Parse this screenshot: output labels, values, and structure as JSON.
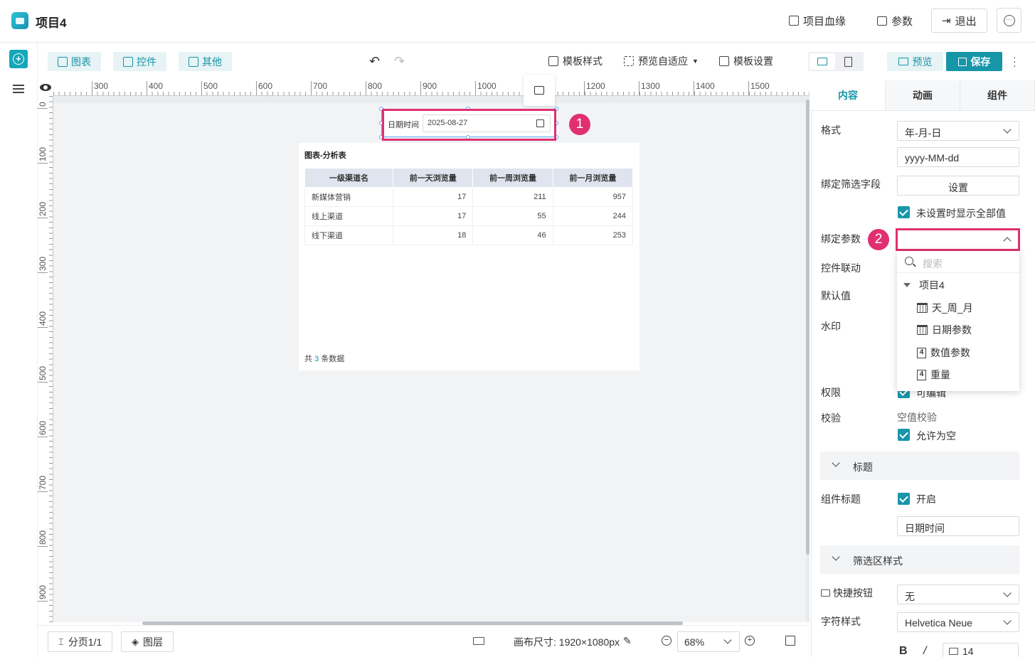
{
  "header": {
    "title": "项目4",
    "lineage_label": "项目血缘",
    "params_label": "参数",
    "exit_label": "退出",
    "more_icon": "ellipsis-icon"
  },
  "toolbar": {
    "chart_label": "图表",
    "control_label": "控件",
    "other_label": "其他",
    "template_style_label": "模板样式",
    "preview_fit_label": "预览自适应",
    "template_settings_label": "模板设置",
    "preview_label": "预览",
    "save_label": "保存"
  },
  "rulers": {
    "h": [
      "300",
      "400",
      "500",
      "600",
      "700",
      "800",
      "900",
      "1000",
      "1200",
      "1300",
      "1400",
      "1500"
    ],
    "v": [
      "0",
      "100",
      "200",
      "300",
      "400",
      "500",
      "600",
      "700",
      "800",
      "900"
    ]
  },
  "date_widget": {
    "label": "日期时间",
    "value": "2025-08-27"
  },
  "table_widget": {
    "title": "图表-分析表",
    "columns": [
      "一级渠道名",
      "前一天浏览量",
      "前一周浏览量",
      "前一月浏览量"
    ],
    "rows": [
      [
        "新媒体营销",
        "17",
        "211",
        "957"
      ],
      [
        "线上渠道",
        "17",
        "55",
        "244"
      ],
      [
        "线下渠道",
        "18",
        "46",
        "253"
      ]
    ],
    "footer_prefix": "共",
    "footer_count": "3",
    "footer_suffix": "条数据"
  },
  "annotations": {
    "badge1": "1",
    "badge2": "2"
  },
  "bottombar": {
    "page_label": "分页1/1",
    "layer_label": "图层",
    "canvas_size_label": "画布尺寸:",
    "canvas_size_value": "1920×1080px",
    "zoom_value": "68%"
  },
  "panel": {
    "tabs": [
      "内容",
      "动画",
      "组件"
    ],
    "format_label": "格式",
    "format_value": "年-月-日",
    "format_pattern": "yyyy-MM-dd",
    "bind_filter_label": "绑定筛选字段",
    "set_button": "设置",
    "show_all_label": "未设置时显示全部值",
    "bind_param_label": "绑定参数",
    "linkage_label": "控件联动",
    "default_label": "默认值",
    "watermark_label": "水印",
    "permission_label": "权限",
    "permission_value": "可编辑",
    "validate_label": "校验",
    "null_check_label": "空值校验",
    "allow_null_label": "允许为空",
    "title_section": "标题",
    "component_title_label": "组件标题",
    "enable_label": "开启",
    "title_value": "日期时间",
    "filter_style_section": "筛选区样式",
    "quick_button_label": "快捷按钮",
    "quick_button_value": "无",
    "font_style_label": "字符样式",
    "font_value": "Helvetica Neue",
    "bold_label": "B",
    "italic_label": "/",
    "font_size_value": "14"
  },
  "dropdown": {
    "search_placeholder": "搜索",
    "group": "项目4",
    "items": [
      {
        "label": "天_周_月",
        "icon": "calendar-icon"
      },
      {
        "label": "日期参数",
        "icon": "calendar-icon"
      },
      {
        "label": "数值参数",
        "icon": "number-icon"
      },
      {
        "label": "重量",
        "icon": "number-icon"
      }
    ]
  },
  "colors": {
    "accent": "#1796a8",
    "highlight": "#e0306f"
  }
}
